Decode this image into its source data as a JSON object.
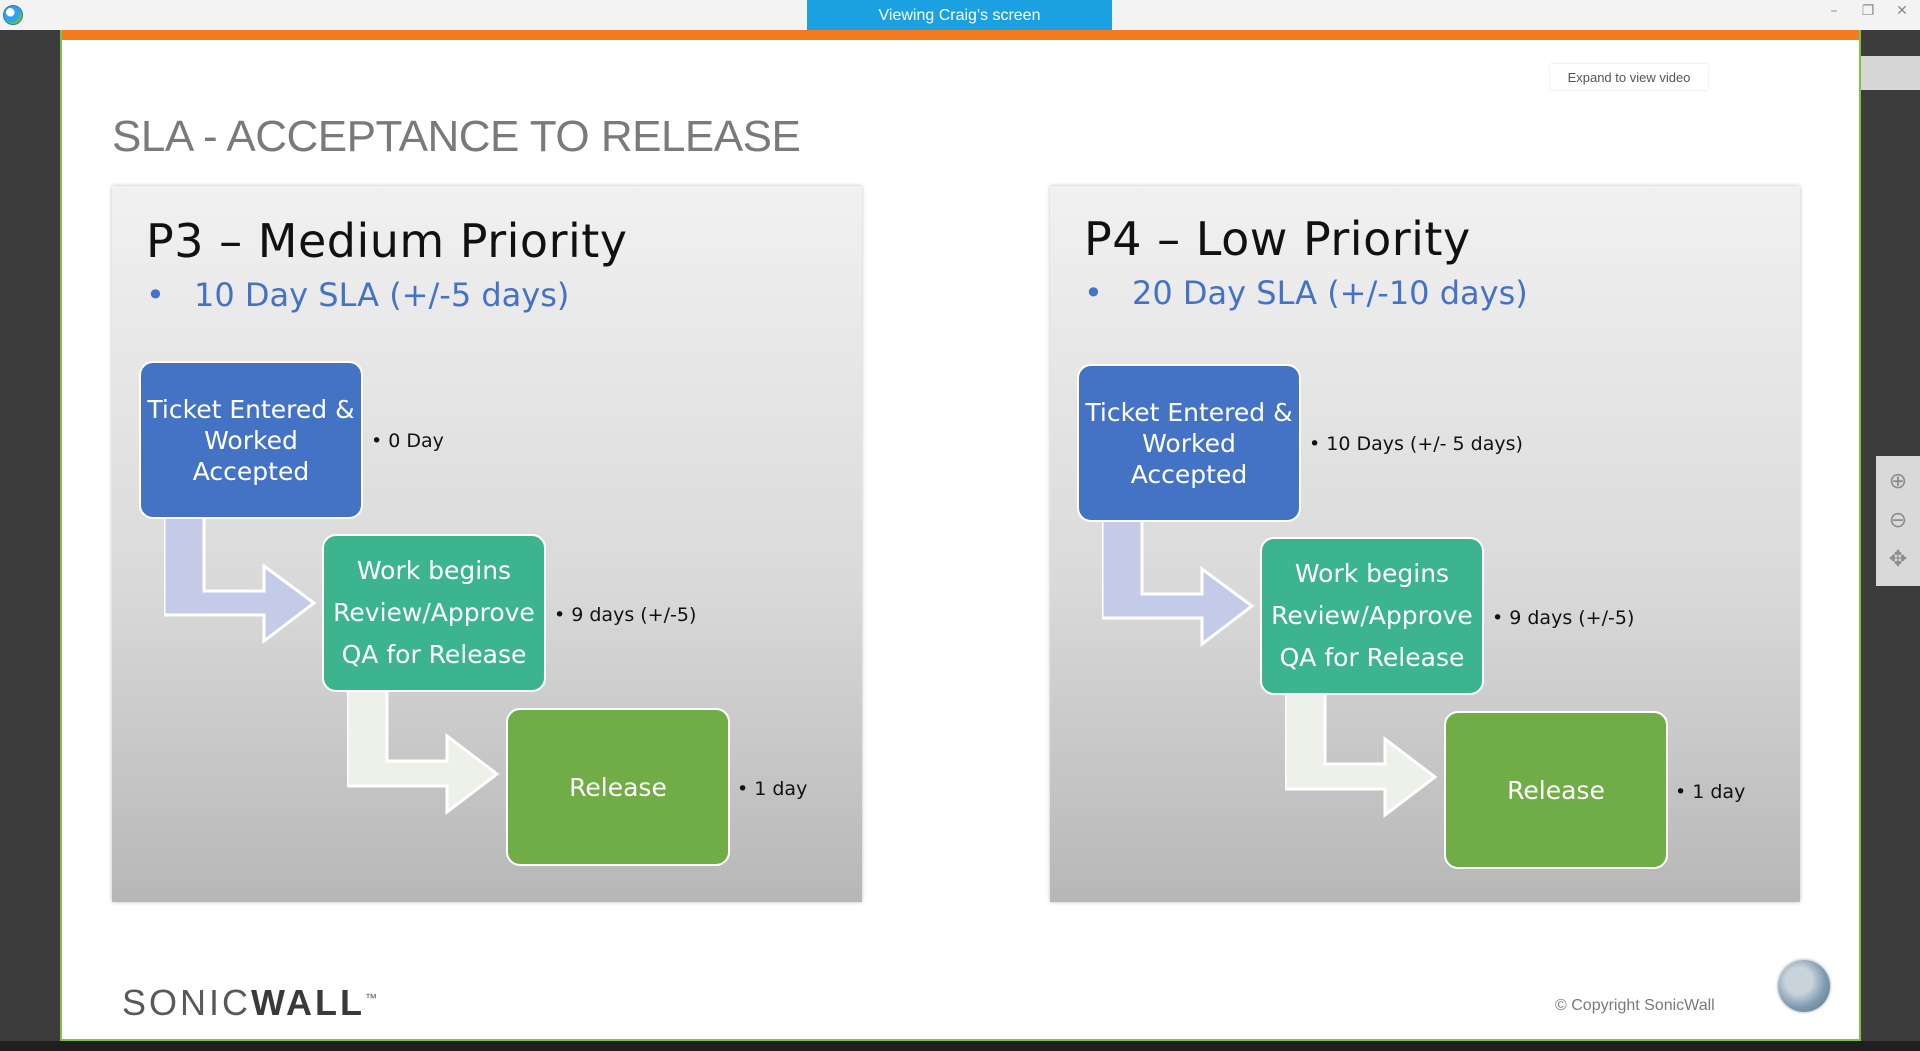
{
  "window": {
    "viewing_label": "Viewing Craig's screen",
    "minimize": "–",
    "restore": "❐",
    "close": "✕"
  },
  "slide": {
    "expand_link": "Expand to view video",
    "title": "SLA - ACCEPTANCE TO RELEASE",
    "panels": [
      {
        "heading": "P3 – Medium Priority",
        "bullet": "•",
        "sla": "10 Day SLA  (+/-5 days)",
        "steps": [
          {
            "lines": [
              "Ticket Entered &",
              "Worked",
              "Accepted"
            ],
            "note": "• 0 Day"
          },
          {
            "lines": [
              "Work begins",
              "Review/Approve",
              "QA for Release"
            ],
            "note": "• 9 days (+/-5)"
          },
          {
            "lines": [
              "Release"
            ],
            "note": "• 1 day"
          }
        ]
      },
      {
        "heading": "P4 – Low Priority",
        "bullet": "•",
        "sla": "20 Day SLA  (+/-10 days)",
        "steps": [
          {
            "lines": [
              "Ticket Entered &",
              "Worked",
              "Accepted"
            ],
            "note": "• 10 Days (+/- 5 days)"
          },
          {
            "lines": [
              "Work begins",
              "Review/Approve",
              "QA for Release"
            ],
            "note": "• 9 days (+/-5)"
          },
          {
            "lines": [
              "Release"
            ],
            "note": "• 1 day"
          }
        ]
      }
    ],
    "logo_prefix": "SONIC",
    "logo_suffix": "WALL",
    "logo_tm": "™",
    "copyright": "© Copyright SonicWall"
  },
  "zoom": {
    "zoom_in": "⊕",
    "zoom_out": "⊖",
    "pan": "✥"
  },
  "colors": {
    "accent": "#f47a20",
    "frame": "#7fc241",
    "viewing_tab": "#1ba1e2",
    "box_blue": "#4472c4",
    "box_teal": "#3cb48e",
    "box_green": "#70ad47",
    "sla_text": "#4472c4"
  }
}
